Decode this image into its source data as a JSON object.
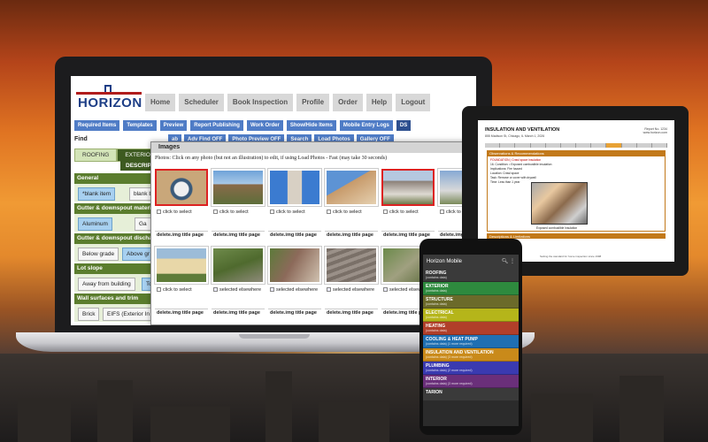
{
  "brand": {
    "logo": "HORIZON"
  },
  "nav": [
    "Home",
    "Scheduler",
    "Book Inspection",
    "Profile",
    "Order",
    "Help",
    "Logout"
  ],
  "toolbar": [
    "Required Items",
    "Templates",
    "Preview",
    "Report Publishing",
    "Work Order",
    "Show/Hide Items",
    "Mobile Entry Logs",
    "DS"
  ],
  "find": {
    "label": "Find"
  },
  "toolbar2": [
    "ab",
    "Adv Find OFF",
    "Photo Preview OFF",
    "Search",
    "Load Photos",
    "Gallery OFF"
  ],
  "tabs": [
    "ROOFING",
    "EXTERIOR"
  ],
  "descr": "DESCRIPT",
  "sections": [
    {
      "title": "General",
      "chips": [
        "*blank item",
        "blank b"
      ]
    },
    {
      "title": "Gutter & downspout material",
      "chips": [
        "Aluminum",
        "Ga"
      ]
    },
    {
      "title": "Gutter & downspout discharg",
      "chips": [
        "Below grade",
        "Above gr"
      ]
    },
    {
      "title": "Lot slope",
      "chips": [
        "Away from building",
        "To"
      ]
    },
    {
      "title": "Wall surfaces and trim",
      "chips": [
        "Brick",
        "EIFS (Exterior In"
      ]
    }
  ],
  "images": {
    "title": "Images",
    "instructions": "Photos: Click on any photo (but not an illustration) to edit, if using Load Photos - Fast (may take 30 seconds)",
    "row1": [
      {
        "sel": "click to select"
      },
      {
        "sel": "click to select"
      },
      {
        "sel": "click to select"
      },
      {
        "sel": "click to select"
      },
      {
        "sel": "click to select"
      },
      {
        "sel": "click to"
      }
    ],
    "row2": [
      {
        "sel": "click to select"
      },
      {
        "sel": "selected elsewhere"
      },
      {
        "sel": "selected elsewhere"
      },
      {
        "sel": "selected elsewhere"
      },
      {
        "sel": "selected elsewhere"
      },
      {
        "sel": "selec"
      }
    ],
    "actions": {
      "delete": "delete.img",
      "title": "title page"
    }
  },
  "report": {
    "title": "INSULATION AND VENTILATION",
    "address": "855 Madison St, Chicago, IL    March 1, 2026",
    "report_no": "Report No. 1234",
    "site": "www.horizon.com",
    "obs_head": "Observations & Recommendations",
    "lines": [
      "FOUNDATION | Crawl space insulation",
      "16. Condition: • Exposed combustible insulation",
      "Implications: Fire hazard",
      "Location: Crawl space",
      "Task: Remove or cover with drywall",
      "Time: Less than 1 year"
    ],
    "photo_caption": "Exposed combustible insulation",
    "lim_head": "Descriptions & Limitations",
    "footer": "Setting the standard for home inspection since 1998"
  },
  "mobile": {
    "title": "Horizon Mobile",
    "items": [
      {
        "name": "ROOFING",
        "sub": "(contains data)",
        "color": "#3a3a3a"
      },
      {
        "name": "EXTERIOR",
        "sub": "(contains data)",
        "color": "#2e8a3e"
      },
      {
        "name": "STRUCTURE",
        "sub": "(contains data)",
        "color": "#6b6a2a"
      },
      {
        "name": "ELECTRICAL",
        "sub": "(contains data)",
        "color": "#b5b51a"
      },
      {
        "name": "HEATING",
        "sub": "(contains data)",
        "color": "#b13f2a"
      },
      {
        "name": "COOLING & HEAT PUMP",
        "sub": "(contains data) (1 more required)",
        "color": "#1f6fb2"
      },
      {
        "name": "INSULATION AND VENTILATION",
        "sub": "(contains data) (3 more required)",
        "color": "#c98a1a"
      },
      {
        "name": "PLUMBING",
        "sub": "(contains data) (2 more required)",
        "color": "#3a3ab0"
      },
      {
        "name": "INTERIOR",
        "sub": "(contains data) (3 more required)",
        "color": "#6a2f7a"
      },
      {
        "name": "TARION",
        "sub": "",
        "color": "#3a3a3a"
      }
    ]
  }
}
